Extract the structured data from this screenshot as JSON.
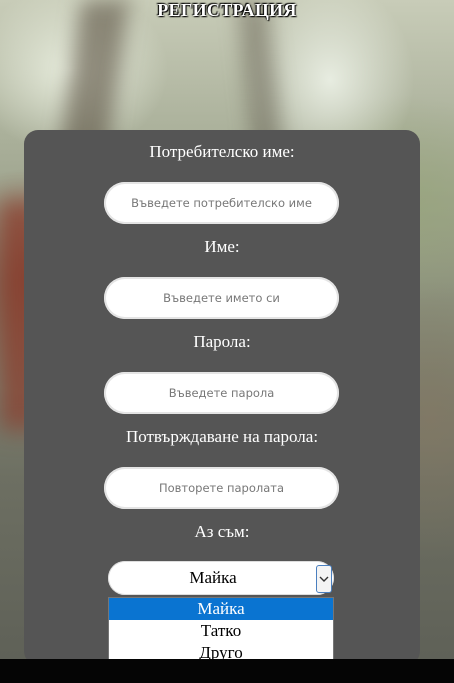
{
  "page": {
    "title": "РЕГИСТРАЦИЯ"
  },
  "form": {
    "username": {
      "label": "Потребителско име:",
      "placeholder": "Въведете потребителско име"
    },
    "name": {
      "label": "Име:",
      "placeholder": "Въведете името си"
    },
    "password": {
      "label": "Парола:",
      "placeholder": "Въведете парола"
    },
    "confirm": {
      "label": "Потвърждаване на парола:",
      "placeholder": "Повторете паролата"
    },
    "role": {
      "label": "Аз съм:",
      "selected": "Майка",
      "options": [
        "Майка",
        "Татко",
        "Друго"
      ],
      "dropdown_open": true
    }
  },
  "colors": {
    "card": "#555555",
    "option_highlight": "#0a74d1"
  }
}
